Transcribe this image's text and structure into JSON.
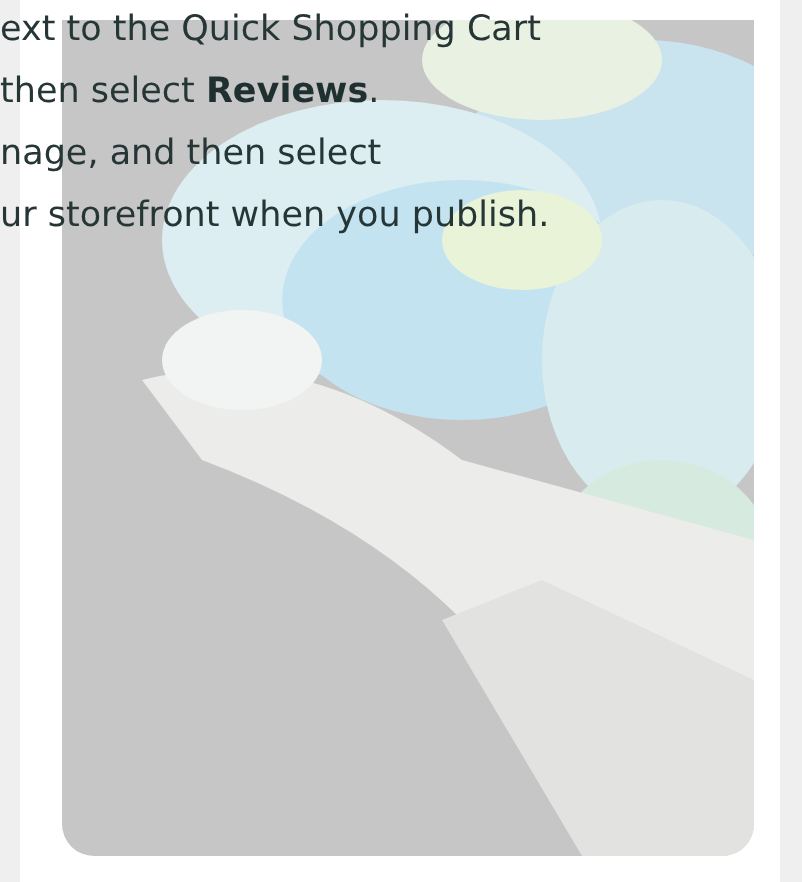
{
  "article": {
    "paragraphs": [
      {
        "lines": [
          "ext to the Quick Shopping Cart"
        ]
      },
      {
        "lines": [
          "then select **Reviews**."
        ]
      },
      {
        "lines": [
          "nage, and then select",
          "ur storefront when you publish."
        ]
      }
    ]
  }
}
